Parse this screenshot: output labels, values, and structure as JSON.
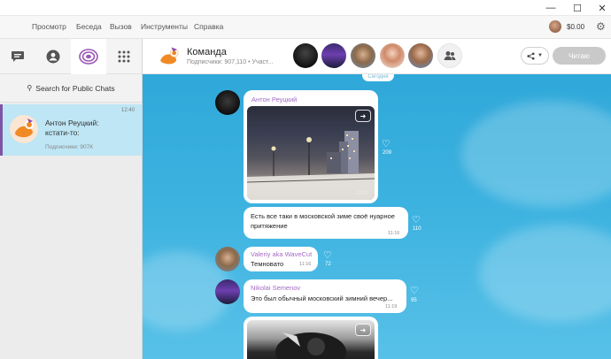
{
  "window": {
    "minimize": "—",
    "maximize": "☐",
    "close": "✕"
  },
  "menu": [
    "Просмотр",
    "Беседа",
    "Вызов",
    "Инструменты",
    "Справка"
  ],
  "account": {
    "balance": "$0.00"
  },
  "sidebar": {
    "search_label": "Search for Public Chats",
    "chats": [
      {
        "name": "Антон Реуцкий:",
        "message": "кстати-то:",
        "subscribers": "Подписчики: 907К",
        "time": "12:40"
      }
    ]
  },
  "header": {
    "title": "Команда",
    "subtitle": "Подписчики: 907,110 • Участ...",
    "read_button": "Читаю"
  },
  "chat": {
    "date_label": "Сегодня",
    "messages": [
      {
        "sender": "Антон Реуцкий",
        "type": "photo",
        "time": "11:10",
        "likes": "209"
      },
      {
        "type": "text",
        "text_line1": "Есть все таки в московской зиме своё нуарное",
        "text_line2": "притяжение",
        "time": "11:16",
        "likes": "110"
      },
      {
        "sender": "Valeriy aka WaveCut",
        "type": "text",
        "text": "Темновато",
        "time": "11:16",
        "likes": "72"
      },
      {
        "sender": "Nikolai Semenov",
        "type": "text",
        "text": "Это был обычный московский зимний вечер...",
        "time": "11:19",
        "likes": "95"
      }
    ]
  },
  "colors": {
    "accent": "#7e55a6",
    "chat_bg": "#3cb2e0",
    "selected_chat": "#bee6f5"
  }
}
